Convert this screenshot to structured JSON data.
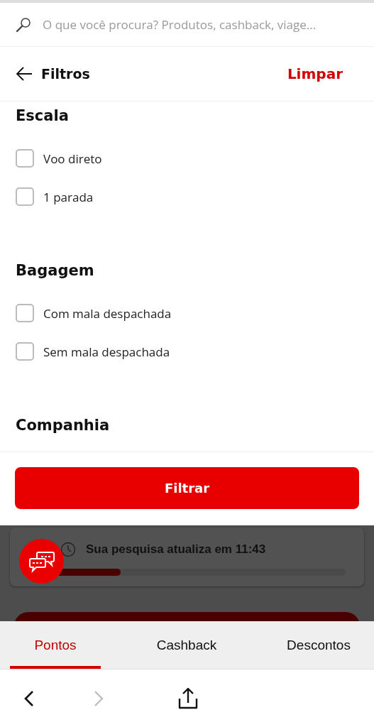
{
  "search": {
    "placeholder": "O que você procura? Produtos, cashback, viage..."
  },
  "header": {
    "title": "Filtros",
    "action": "Limpar"
  },
  "sections": [
    {
      "title": "Escala",
      "options": [
        {
          "label": "Voo direto",
          "checked": false
        },
        {
          "label": "1 parada",
          "checked": false
        }
      ]
    },
    {
      "title": "Bagagem",
      "options": [
        {
          "label": "Com mala despachada",
          "checked": false
        },
        {
          "label": "Sem mala despachada",
          "checked": false
        }
      ]
    },
    {
      "title": "Companhia"
    }
  ],
  "apply_button": "Filtrar",
  "update_notice": {
    "text": "Sua pesquisa atualiza em 11:43",
    "level": 0.22
  },
  "tabs": [
    {
      "label": "Pontos",
      "selected": true
    },
    {
      "label": "Cashback",
      "selected": false
    },
    {
      "label": "Descontos",
      "selected": false
    }
  ],
  "browser_nav": {
    "back_disabled": false,
    "forward_disabled": true
  }
}
